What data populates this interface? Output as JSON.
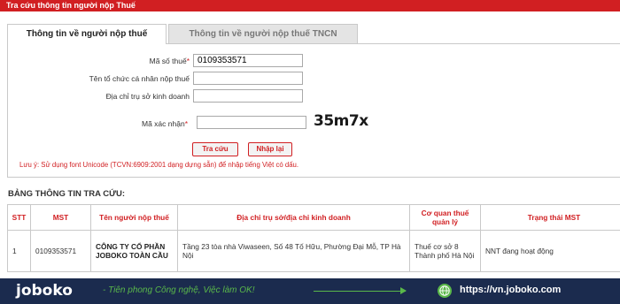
{
  "header": {
    "title": "Tra cứu thông tin người nộp Thuế"
  },
  "tabs": [
    {
      "label": "Thông tin về người nộp thuế",
      "active": true
    },
    {
      "label": "Thông tin về người nộp thuế TNCN",
      "active": false
    }
  ],
  "form": {
    "tax_code_label": "Mã số thuế",
    "tax_code_value": "0109353571",
    "org_name_label": "Tên tổ chức cá nhân nộp thuế",
    "org_name_value": "",
    "address_label": "Địa chỉ trụ sở kinh doanh",
    "address_value": "",
    "captcha_label": "Mã xác nhận",
    "captcha_value": "",
    "captcha_text": "35m7x",
    "required_mark": "*",
    "search_button": "Tra cứu",
    "reset_button": "Nhập lại",
    "note": "Lưu ý: Sử dụng font Unicode (TCVN:6909:2001 dạng dựng sẵn) để nhập tiếng Việt có dấu."
  },
  "results": {
    "section_title": "BẢNG THÔNG TIN TRA CỨU:",
    "columns": [
      "STT",
      "MST",
      "Tên người nộp thuế",
      "Địa chỉ trụ sở/địa chỉ kinh doanh",
      "Cơ quan thuế quản lý",
      "Trạng thái MST"
    ],
    "rows": [
      {
        "stt": "1",
        "mst": "0109353571",
        "name": "CÔNG TY CỔ PHẦN JOBOKO TOÀN CẦU",
        "address": "Tầng 23 tòa nhà Viwaseen, Số 48 Tố Hữu, Phường Đại Mỗ, TP Hà Nội",
        "agency": "Thuế cơ sở 8 Thành phố Hà Nội",
        "status": "NNT đang hoạt động"
      }
    ]
  },
  "footer": {
    "logo_text": "joboko",
    "slogan": "- Tiên phong Công nghệ, Việc làm OK!",
    "url": "https://vn.joboko.com",
    "accent_color": "#5ab84a",
    "background_color": "#1b2b4e"
  }
}
